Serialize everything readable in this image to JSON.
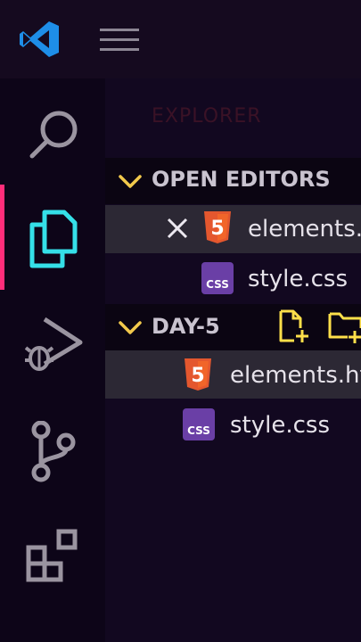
{
  "sidebar": {
    "title": "EXPLORER",
    "open_editors": {
      "label": "OPEN EDITORS",
      "files": [
        {
          "name": "elements.html",
          "icon": "html5-icon",
          "active": true
        },
        {
          "name": "style.css",
          "icon": "css-icon",
          "active": false
        }
      ]
    },
    "folder": {
      "label": "DAY-5",
      "files": [
        {
          "name": "elements.html",
          "icon": "html5-icon",
          "selected": true
        },
        {
          "name": "style.css",
          "icon": "css-icon",
          "selected": false
        }
      ]
    }
  },
  "icons": {
    "html_badge": "5",
    "css_badge": "CSS"
  },
  "colors": {
    "accent": "#ff2d7a",
    "explorer_icon": "#35e0e8",
    "new_file_icon": "#ffe04a",
    "html5": "#e4572e",
    "css": "#6a3fa6"
  }
}
